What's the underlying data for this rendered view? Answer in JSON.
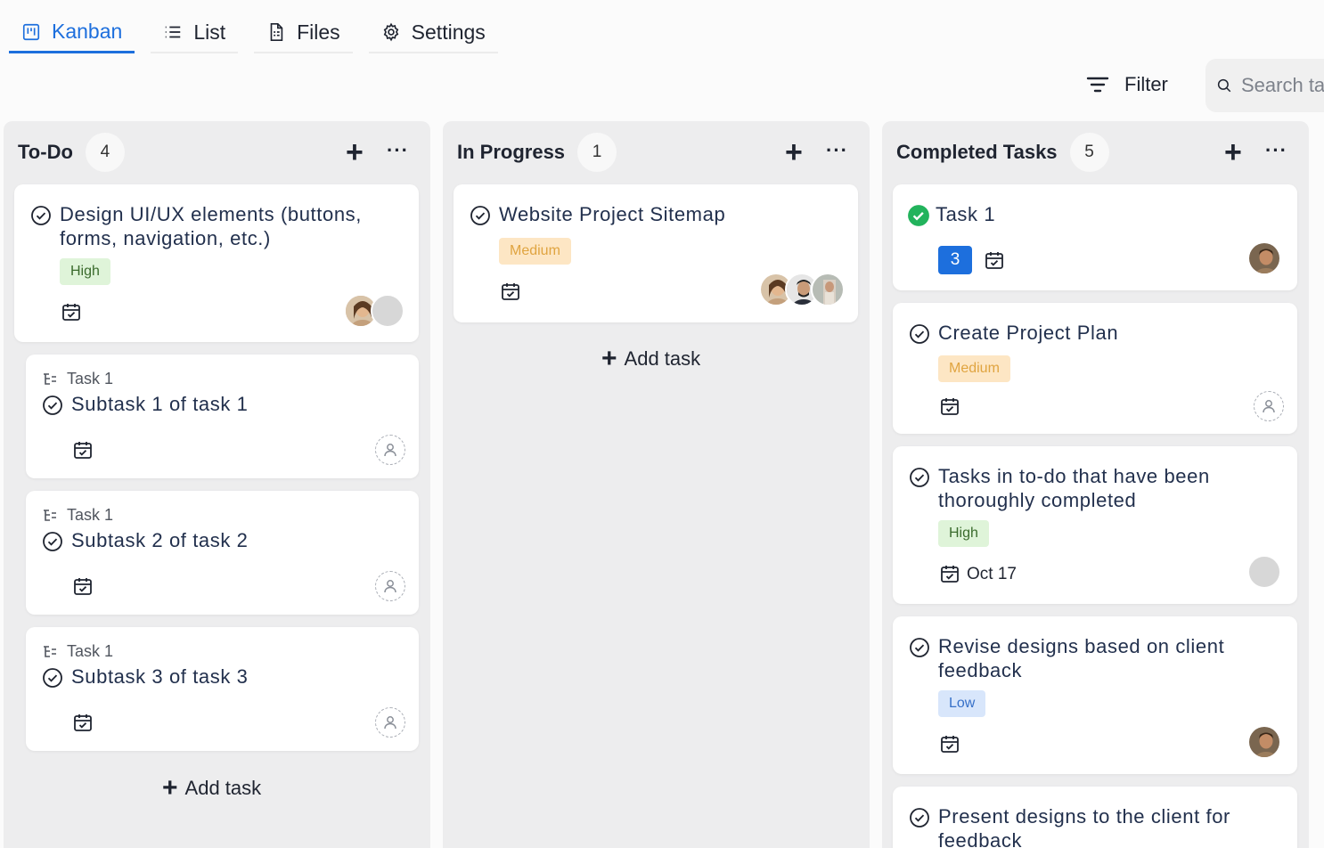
{
  "tabs": [
    {
      "label": "Kanban",
      "icon": "kanban-icon",
      "active": true
    },
    {
      "label": "List",
      "icon": "list-icon",
      "active": false
    },
    {
      "label": "Files",
      "icon": "file-icon",
      "active": false
    },
    {
      "label": "Settings",
      "icon": "gear-icon",
      "active": false
    }
  ],
  "toolbar": {
    "filter_label": "Filter",
    "search_placeholder": "Search tasks"
  },
  "colors": {
    "accent": "#1d6fdd",
    "high": "#dff4d9",
    "medium": "#fde6c4",
    "low": "#d8e6fb",
    "done": "#22b35c"
  },
  "columns": [
    {
      "title": "To-Do",
      "count": "4",
      "add_label": "Add task",
      "cards": [
        {
          "title": "Design UI/UX elements (buttons, forms, navigation, etc.)",
          "priority": "High"
        },
        {
          "parent": "Task 1",
          "title": "Subtask 1 of task 1"
        },
        {
          "parent": "Task 1",
          "title": "Subtask 2 of task 2"
        },
        {
          "parent": "Task 1",
          "title": "Subtask 3 of task 3"
        }
      ]
    },
    {
      "title": "In Progress",
      "count": "1",
      "add_label": "Add task",
      "cards": [
        {
          "title": "Website Project Sitemap",
          "priority": "Medium"
        }
      ]
    },
    {
      "title": "Completed Tasks",
      "count": "5",
      "cards": [
        {
          "title": "Task 1",
          "subtask_count": "3"
        },
        {
          "title": "Create Project Plan",
          "priority": "Medium"
        },
        {
          "title": "Tasks in to-do that have been thoroughly completed",
          "priority": "High",
          "due": "Oct 17"
        },
        {
          "title": "Revise designs based on client feedback",
          "priority": "Low"
        },
        {
          "title": "Present designs to the client for feedback"
        }
      ]
    }
  ]
}
